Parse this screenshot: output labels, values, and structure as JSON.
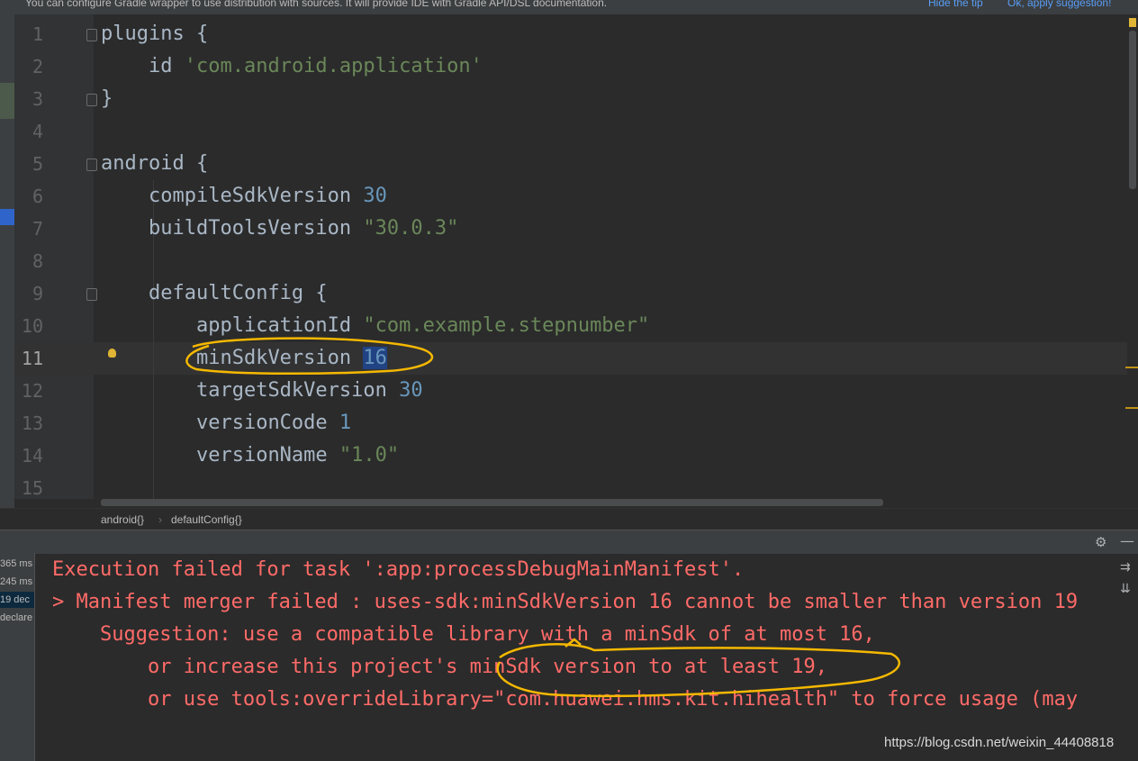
{
  "tip": {
    "message": "You can configure Gradle wrapper to use distribution with sources. It will provide IDE with Gradle API/DSL documentation.",
    "hide_link": "Hide the tip",
    "apply_link": "Ok, apply suggestion!"
  },
  "editor": {
    "current_line": 11,
    "line_numbers": [
      "1",
      "2",
      "3",
      "4",
      "5",
      "6",
      "7",
      "8",
      "9",
      "10",
      "11",
      "12",
      "13",
      "14",
      "15"
    ],
    "lines": {
      "l1": "plugins {",
      "l2_id": "id ",
      "l2_str": "'com.android.application'",
      "l3": "}",
      "l5": "android {",
      "l6_key": "compileSdkVersion ",
      "l6_num": "30",
      "l7_key": "buildToolsVersion ",
      "l7_str": "\"30.0.3\"",
      "l9": "defaultConfig {",
      "l10_key": "applicationId ",
      "l10_str": "\"com.example.stepnumber\"",
      "l11_key": "minSdkVersion ",
      "l11_num": "16",
      "l12_key": "targetSdkVersion ",
      "l12_num": "30",
      "l13_key": "versionCode ",
      "l13_num": "1",
      "l14_key": "versionName ",
      "l14_str": "\"1.0\""
    },
    "breadcrumb": [
      "android{}",
      "defaultConfig{}"
    ],
    "breadcrumb_sep": "›"
  },
  "build_panel": {
    "left_items": [
      "365 ms",
      "245 ms",
      "19 dec",
      "declare"
    ],
    "output": [
      "Execution failed for task ':app:processDebugMainManifest'.",
      "> Manifest merger failed : uses-sdk:minSdkVersion 16 cannot be smaller than version 19",
      "    Suggestion: use a compatible library with a minSdk of at most 16,",
      "        or increase this project's minSdk version to at least 19,",
      "        or use tools:overrideLibrary=\"com.huawei.hms.kit.hihealth\" to force usage (may"
    ]
  },
  "watermark": "https://blog.csdn.net/weixin_44408818",
  "colors": {
    "editor_bg": "#2b2b2b",
    "keyword_text": "#a9b7c6",
    "string": "#6a8759",
    "number": "#6897bb",
    "error_text": "#ff6b68",
    "annotation": "#f5b800",
    "link": "#589df6"
  },
  "icons": {
    "gear": "⚙",
    "minimize": "—",
    "wrap": "⇉",
    "scroll_end": "⇊"
  }
}
